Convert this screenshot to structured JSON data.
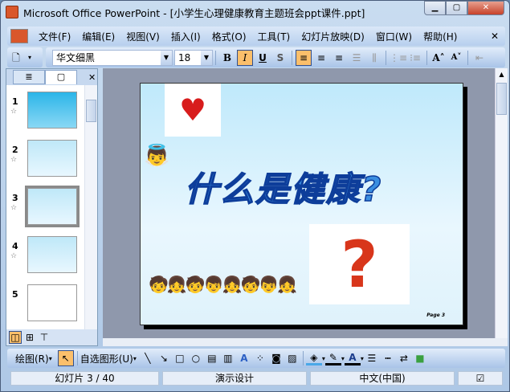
{
  "window": {
    "title": "Microsoft Office PowerPoint - [小学生心理健康教育主题班会ppt课件.ppt]"
  },
  "menu": [
    "文件(F)",
    "编辑(E)",
    "视图(V)",
    "插入(I)",
    "格式(O)",
    "工具(T)",
    "幻灯片放映(D)",
    "窗口(W)",
    "帮助(H)"
  ],
  "format": {
    "font": "华文细黑",
    "size": "18",
    "bold": "B",
    "italic": "I",
    "underline": "U",
    "shadow": "S"
  },
  "thumbnails": [
    {
      "n": "1"
    },
    {
      "n": "2"
    },
    {
      "n": "3"
    },
    {
      "n": "4"
    },
    {
      "n": "5"
    }
  ],
  "slide": {
    "heading": "什么是健康?",
    "page": "Page  3"
  },
  "drawing": {
    "draw": "绘图(R)",
    "autoshapes": "自选图形(U)"
  },
  "status": {
    "slide": "幻灯片 3 / 40",
    "design": "演示设计",
    "language": "中文(中国)"
  }
}
